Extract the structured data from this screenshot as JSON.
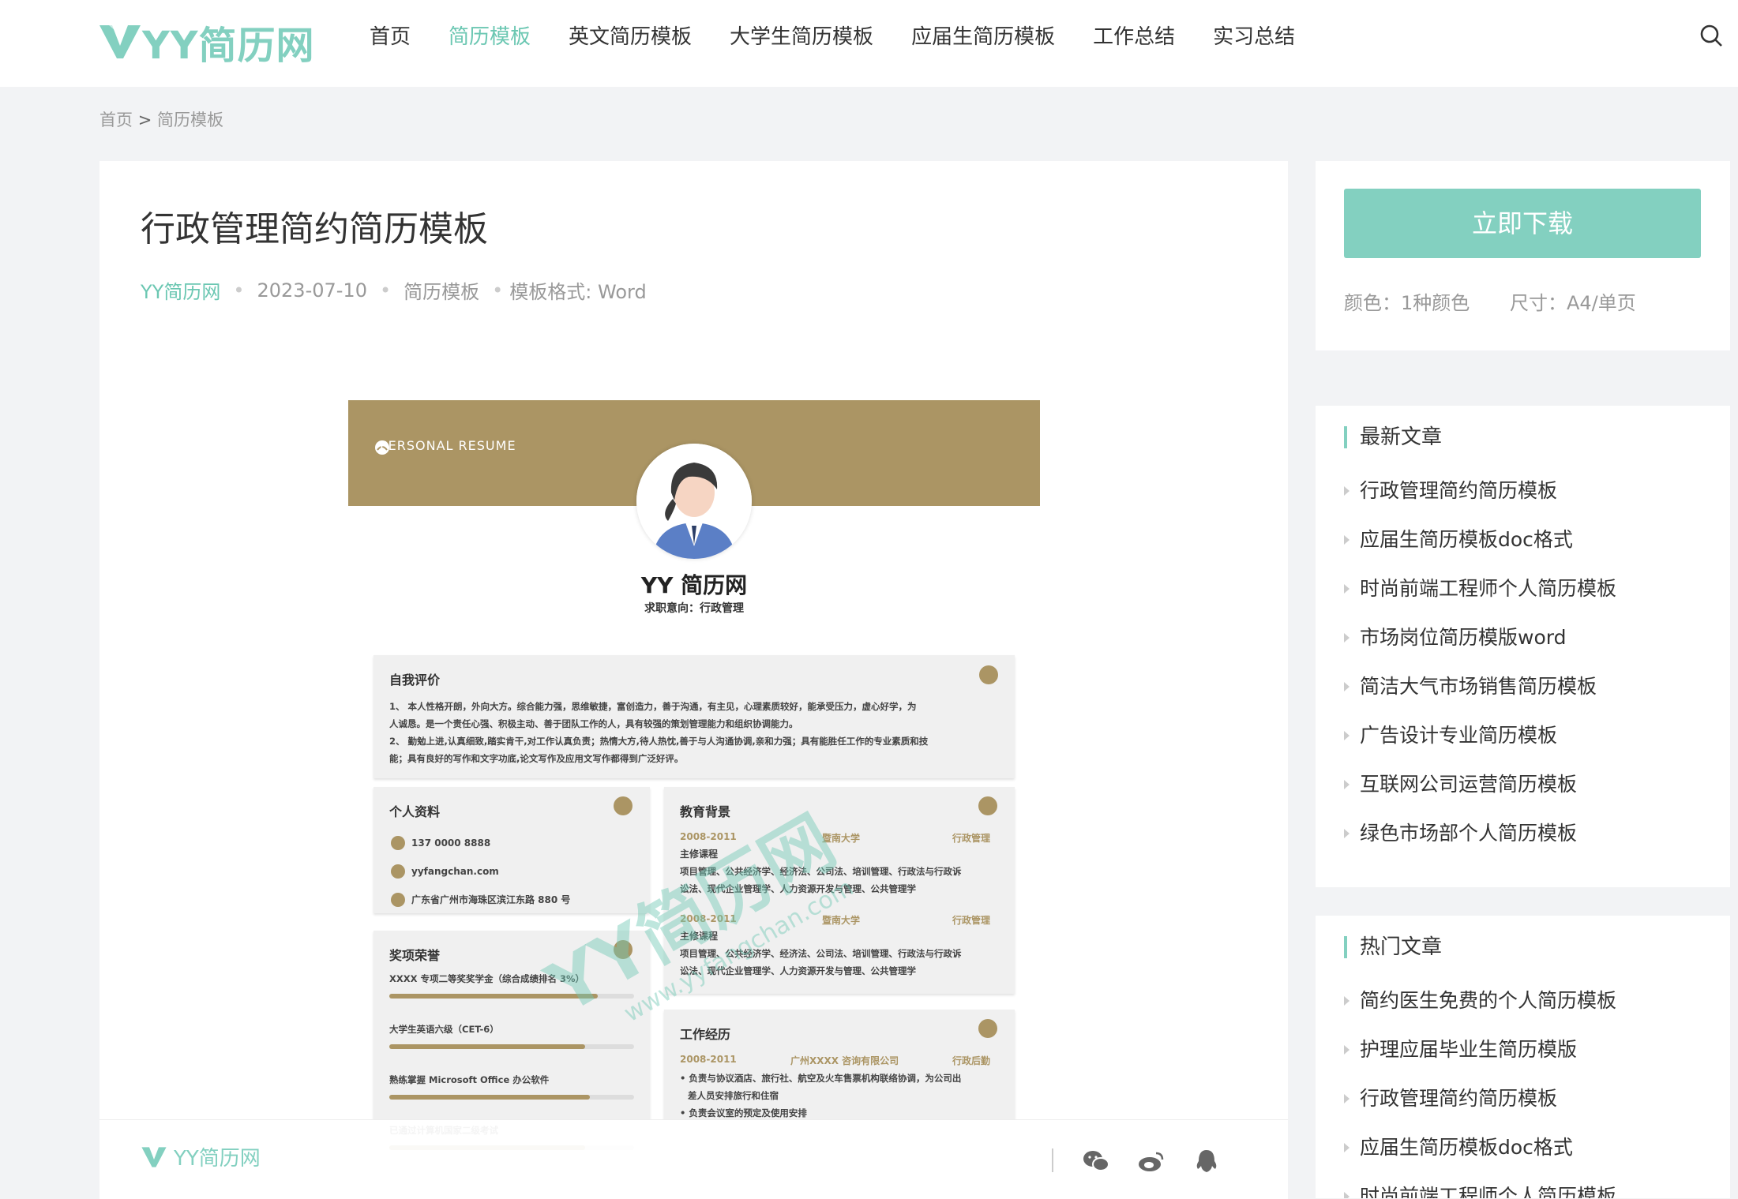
{
  "header": {
    "logo_text": "YY简历网",
    "nav": [
      "首页",
      "简历模板",
      "英文简历模板",
      "大学生简历模板",
      "应届生简历模板",
      "工作总结",
      "实习总结"
    ],
    "active_index": 1,
    "search_icon": "search-icon"
  },
  "breadcrumb": {
    "home": "首页",
    "sep": ">",
    "current": "简历模板"
  },
  "article": {
    "title": "行政管理简约简历模板",
    "author": "YY简历网",
    "date": "2023-07-10",
    "category": "简历模板",
    "format": "模板格式: Word"
  },
  "resume": {
    "banner": "PERSONAL RESUME",
    "name": "YY 简历网",
    "intent": "求职意向：行政管理",
    "eval_title": "自我评价",
    "eval_lines": [
      "1、 本人性格开朗，外向大方。综合能力强，思维敏捷，富创造力，善于沟通，有主见，心理素质较好，能承受压力，虚心好学，为",
      "人诚恳。是一个责任心强、积极主动、善于团队工作的人，具有较强的策划管理能力和组织协调能力。",
      "2、 勤勉上进,认真细致,踏实肯干,对工作认真负责；热情大方,待人热忱,善于与人沟通协调,亲和力强；具有能胜任工作的专业素质和技",
      "能；具有良好的写作和文字功底,论文写作及应用文写作都得到广泛好评。"
    ],
    "info_title": "个人资料",
    "phone": "137 0000 8888",
    "email": "yyfangchan.com",
    "address": "广东省广州市海珠区滨江东路 880 号",
    "awards_title": "奖项荣誉",
    "awards": [
      {
        "label": "XXXX 专项二等奖奖学金（综合成绩排名 3%）",
        "level": 0.85
      },
      {
        "label": "大学生英语六级（CET-6）",
        "level": 0.8
      },
      {
        "label": "熟练掌握 Microsoft Office 办公软件",
        "level": 0.82
      },
      {
        "label": "已通过计算机国家二级考试",
        "level": 0.8
      }
    ],
    "edu_title": "教育背景",
    "edu": [
      {
        "period": "2008-2011",
        "school": "暨南大学",
        "major": "行政管理",
        "course": "主修课程",
        "lines": [
          "项目管理、公共经济学、经济法、公司法、培训管理、行政法与行政诉",
          "讼法、现代企业管理学、人力资源开发与管理、公共管理学"
        ]
      },
      {
        "period": "2008-2011",
        "school": "暨南大学",
        "major": "行政管理",
        "course": "主修课程",
        "lines": [
          "项目管理、公共经济学、经济法、公司法、培训管理、行政法与行政诉",
          "讼法、现代企业管理学、人力资源开发与管理、公共管理学"
        ]
      }
    ],
    "work_title": "工作经历",
    "work": {
      "period": "2008-2011",
      "company": "广州XXXX 咨询有限公司",
      "role": "行政后勤",
      "lines": [
        "• 负责与协议酒店、旅行社、航空及火车售票机构联络协调，为公司出",
        "差人员安排旅行和住宿",
        "• 负责会议室的预定及使用安排"
      ]
    },
    "watermark": "YY简历网",
    "watermark_url": "www.yyfangchan.com"
  },
  "footbar": {
    "logo_text": "YY简历网"
  },
  "sidebar": {
    "download_label": "立即下载",
    "color_info": "颜色：1种颜色",
    "size_info": "尺寸：A4/单页",
    "latest_title": "最新文章",
    "latest": [
      "行政管理简约简历模板",
      "应届生简历模板doc格式",
      "时尚前端工程师个人简历模板",
      "市场岗位简历模版word",
      "简洁大气市场销售简历模板",
      "广告设计专业简历模板",
      "互联网公司运营简历模板",
      "绿色市场部个人简历模板"
    ],
    "hot_title": "热门文章",
    "hot": [
      "简约医生免费的个人简历模板",
      "护理应届毕业生简历模版",
      "行政管理简约简历模板",
      "应届生简历模板doc格式",
      "时尚前端工程师个人简历模板"
    ]
  },
  "colors": {
    "accent": "#83d0c0",
    "accent_text": "#6bc7b2",
    "resume_gold": "#ab9564"
  }
}
